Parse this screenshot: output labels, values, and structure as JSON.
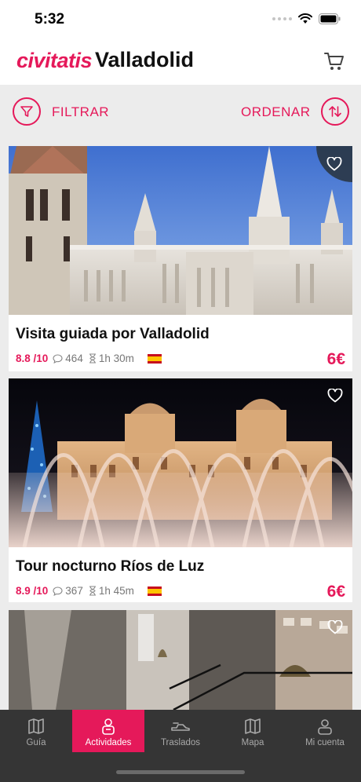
{
  "status_bar": {
    "time": "5:32"
  },
  "header": {
    "logo": "civitatis",
    "city": "Valladolid"
  },
  "toolbar": {
    "filter_label": "FILTRAR",
    "sort_label": "ORDENAR"
  },
  "cards": [
    {
      "title": "Visita guiada por Valladolid",
      "rating": "8.8 /10",
      "reviews": "464",
      "duration": "1h 30m",
      "price": "6€"
    },
    {
      "title": "Tour nocturno Ríos de Luz",
      "rating": "8.9 /10",
      "reviews": "367",
      "duration": "1h 45m",
      "price": "6€"
    }
  ],
  "tabs": [
    {
      "label": "Guía",
      "icon": "map-book-icon"
    },
    {
      "label": "Actividades",
      "icon": "activities-icon"
    },
    {
      "label": "Traslados",
      "icon": "transfer-icon"
    },
    {
      "label": "Mapa",
      "icon": "map-icon"
    },
    {
      "label": "Mi cuenta",
      "icon": "account-icon"
    }
  ],
  "colors": {
    "brand": "#e5195a",
    "tab_bar": "#353535",
    "background": "#ececec"
  }
}
